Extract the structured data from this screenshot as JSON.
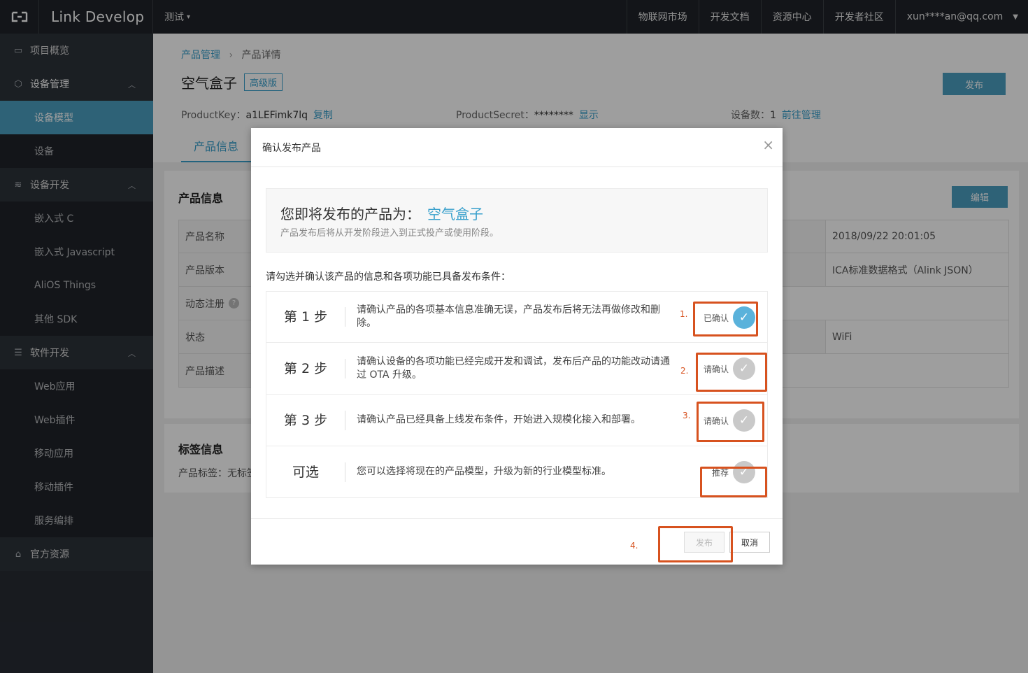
{
  "topbar": {
    "brand": "Link Develop",
    "project": "测试",
    "nav": [
      "物联网市场",
      "开发文档",
      "资源中心",
      "开发者社区"
    ],
    "user": "xun****an@qq.com"
  },
  "sidebar": {
    "overview": "项目概览",
    "device_mgmt": "设备管理",
    "device_model": "设备模型",
    "device": "设备",
    "device_dev": "设备开发",
    "embedded_c": "嵌入式 C",
    "embedded_js": "嵌入式 Javascript",
    "alios": "AliOS Things",
    "other_sdk": "其他 SDK",
    "software_dev": "软件开发",
    "web_app": "Web应用",
    "web_plugin": "Web插件",
    "mobile_app": "移动应用",
    "mobile_plugin": "移动插件",
    "service_orch": "服务编排",
    "official": "官方资源"
  },
  "page": {
    "crumb_root": "产品管理",
    "crumb_current": "产品详情",
    "title": "空气盒子",
    "badge": "高级版",
    "publish": "发布",
    "product_key_label": "ProductKey：",
    "product_key": "a1LEFimk7lq",
    "copy": "复制",
    "product_secret_label": "ProductSecret：",
    "product_secret": "********",
    "show": "显示",
    "device_count_label": "设备数：",
    "device_count": "1",
    "manage": "前往管理",
    "tab": "产品信息",
    "info_title": "产品信息",
    "edit": "编辑",
    "rows": [
      {
        "label": "产品名称",
        "right": "2018/09/22 20:01:05"
      },
      {
        "label": "产品版本",
        "right": "ICA标准数据格式（Alink JSON）"
      },
      {
        "label": "动态注册",
        "right": ""
      },
      {
        "label": "状态",
        "right": "WiFi"
      },
      {
        "label": "产品描述",
        "right": ""
      }
    ],
    "tags_title": "标签信息",
    "tags_line": "产品标签：无标签"
  },
  "modal": {
    "title": "确认发布产品",
    "summary_prefix": "您即将发布的产品为：",
    "product_name": "空气盒子",
    "summary_sub": "产品发布后将从开发阶段进入到正式投产或使用阶段。",
    "instruction": "请勾选并确认该产品的信息和各项功能已具备发布条件：",
    "steps": [
      {
        "label": "第 1 步",
        "desc": "请确认产品的各项基本信息准确无误，产品发布后将无法再做修改和删除。",
        "status": "已确认",
        "done": true
      },
      {
        "label": "第 2 步",
        "desc": "请确认设备的各项功能已经完成开发和调试，发布后产品的功能改动请通过 OTA 升级。",
        "status": "请确认",
        "done": false
      },
      {
        "label": "第 3 步",
        "desc": "请确认产品已经具备上线发布条件，开始进入规模化接入和部署。",
        "status": "请确认",
        "done": false
      },
      {
        "label": "可选",
        "desc": "您可以选择将现在的产品模型，升级为新的行业模型标准。",
        "status": "推荐",
        "done": false
      }
    ],
    "publish": "发布",
    "cancel": "取消"
  },
  "annotations": [
    "1.",
    "2.",
    "3.",
    "4."
  ],
  "colors": {
    "accent": "#39a0cc",
    "sidebar_active": "#4b9ec1",
    "annotation": "#d7521f"
  }
}
